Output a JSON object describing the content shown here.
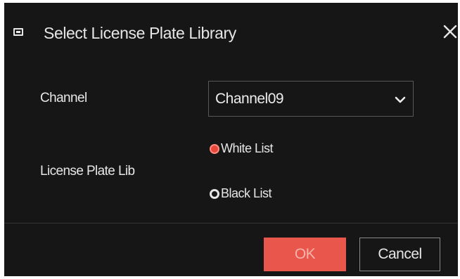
{
  "dialog": {
    "title": "Select License Plate Library",
    "icon": "library-icon",
    "close_icon": "close-icon"
  },
  "channel": {
    "label": "Channel",
    "selected_value": "Channel09",
    "dropdown_icon": "chevron-down-icon"
  },
  "plate_lib": {
    "label": "License Plate Lib",
    "options": [
      {
        "label": "White List",
        "selected": true
      },
      {
        "label": "Black List",
        "selected": false
      }
    ]
  },
  "buttons": {
    "ok_label": "OK",
    "cancel_label": "Cancel"
  },
  "colors": {
    "background": "#161616",
    "accent": "#e8564c",
    "text": "#e6e6e6"
  }
}
